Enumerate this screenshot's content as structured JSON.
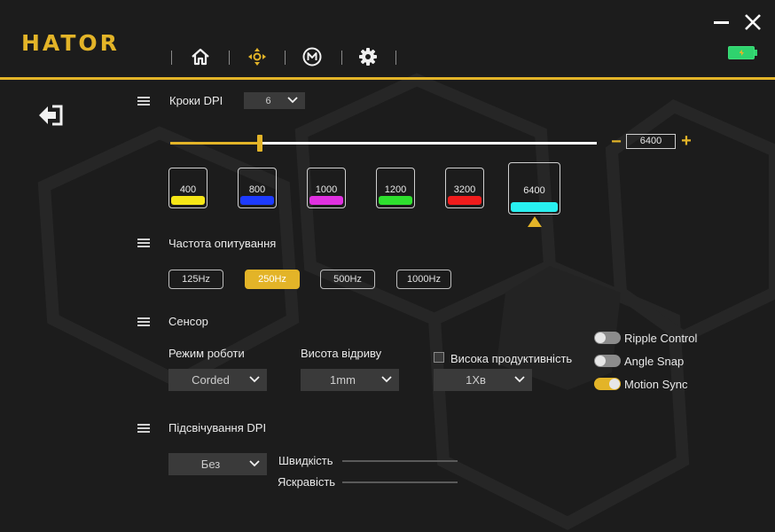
{
  "app": {
    "logo": "HATOR"
  },
  "nav": {
    "items": [
      {
        "name": "home-icon"
      },
      {
        "name": "dpi-icon"
      },
      {
        "name": "macro-icon"
      },
      {
        "name": "gear-icon"
      }
    ]
  },
  "window": {
    "minimize_icon": "minimize-icon",
    "close_icon": "close-icon"
  },
  "battery": {
    "level": 1.0,
    "charging": true,
    "color": "#2fd36e"
  },
  "dpi_steps": {
    "title": "Кроки DPI",
    "count": "6",
    "current_value": "6400",
    "slider_level": 0.21,
    "minus": "−",
    "plus": "+",
    "levels": [
      {
        "value": "400",
        "color": "#f5e616"
      },
      {
        "value": "800",
        "color": "#1d3bff"
      },
      {
        "value": "1000",
        "color": "#e030e0"
      },
      {
        "value": "1200",
        "color": "#2ee02e"
      },
      {
        "value": "3200",
        "color": "#f01c1c"
      },
      {
        "value": "6400",
        "color": "#28f0f0",
        "selected": true
      }
    ]
  },
  "polling": {
    "title": "Частота опитування",
    "options": [
      "125Hz",
      "250Hz",
      "500Hz",
      "1000Hz"
    ],
    "selected": "250Hz"
  },
  "sensor": {
    "title": "Сенсор",
    "mode_label": "Режим роботи",
    "mode_value": "Corded",
    "lod_label": "Висота відриву",
    "lod_value": "1mm",
    "high_perf_label": "Висока продуктивність",
    "high_perf_checked": false,
    "high_perf_value": "1Хв",
    "toggles": [
      {
        "label": "Ripple Control",
        "on": false
      },
      {
        "label": "Angle Snap",
        "on": false
      },
      {
        "label": "Motion Sync",
        "on": true
      }
    ]
  },
  "dpi_lighting": {
    "title": "Підсвічування DPI",
    "mode_value": "Без",
    "speed_label": "Швидкість",
    "brightness_label": "Яскравість"
  },
  "colors": {
    "accent": "#e3b428",
    "background": "#1c1c1c"
  }
}
